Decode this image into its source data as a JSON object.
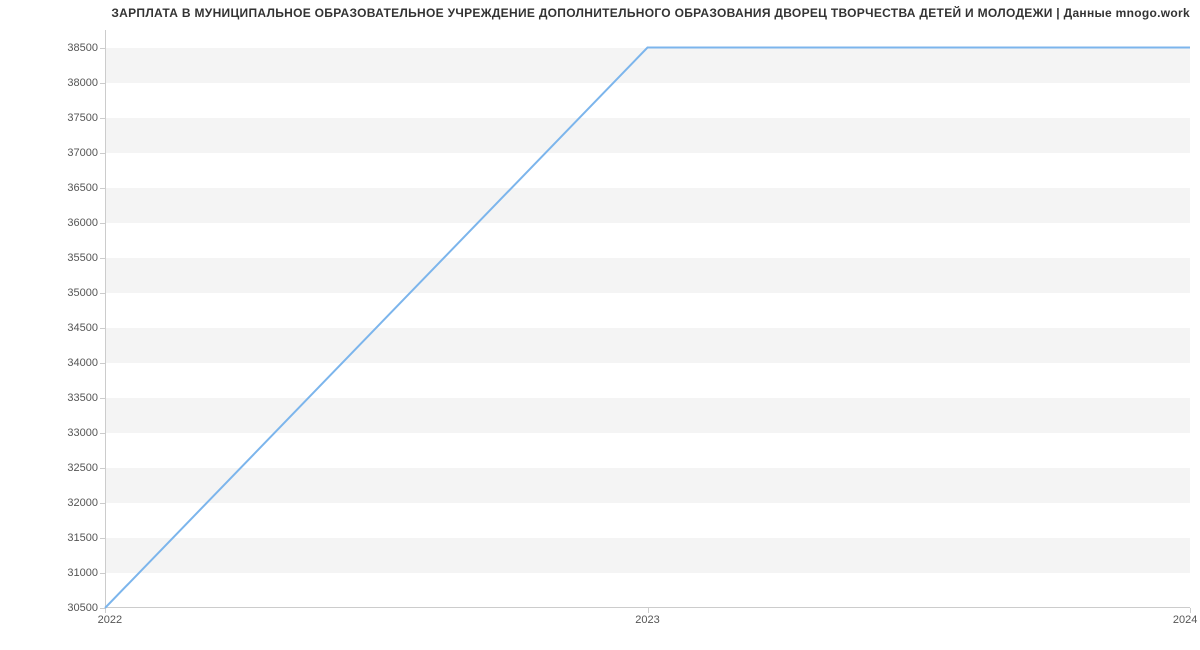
{
  "chart_data": {
    "type": "line",
    "title": "ЗАРПЛАТА В МУНИЦИПАЛЬНОЕ ОБРАЗОВАТЕЛЬНОЕ УЧРЕЖДЕНИЕ ДОПОЛНИТЕЛЬНОГО ОБРАЗОВАНИЯ ДВОРЕЦ ТВОРЧЕСТВА ДЕТЕЙ И МОЛОДЕЖИ | Данные mnogo.work",
    "x": [
      2022,
      2023,
      2024
    ],
    "values": [
      30500,
      38500,
      38500
    ],
    "x_ticks": [
      2022,
      2023,
      2024
    ],
    "y_ticks": [
      30500,
      31000,
      31500,
      32000,
      32500,
      33000,
      33500,
      34000,
      34500,
      35000,
      35500,
      36000,
      36500,
      37000,
      37500,
      38000,
      38500
    ],
    "ylim": [
      30500,
      38750
    ],
    "xlim": [
      2022,
      2024
    ],
    "line_color": "#7cb5ec",
    "xlabel": "",
    "ylabel": ""
  }
}
